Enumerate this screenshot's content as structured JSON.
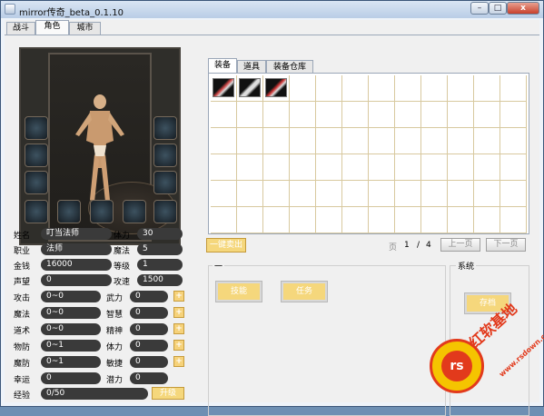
{
  "window": {
    "title": "mirror传奇_beta_0.1.10",
    "minimize": "–",
    "maximize": "□",
    "close": "x"
  },
  "main_tabs": [
    {
      "label": "战斗"
    },
    {
      "label": "角色"
    },
    {
      "label": "城市"
    }
  ],
  "character": {
    "left_stats": [
      {
        "label": "姓名",
        "value": "叮当法师"
      },
      {
        "label": "职业",
        "value": "法师"
      },
      {
        "label": "金钱",
        "value": "16000"
      },
      {
        "label": "声望",
        "value": "0"
      },
      {
        "label": "攻击",
        "value": "0~0"
      },
      {
        "label": "魔法",
        "value": "0~0"
      },
      {
        "label": "道术",
        "value": "0~0"
      },
      {
        "label": "物防",
        "value": "0~1"
      },
      {
        "label": "魔防",
        "value": "0~1"
      },
      {
        "label": "幸运",
        "value": "0"
      },
      {
        "label": "经验",
        "value": "0/50"
      }
    ],
    "right_stats": [
      {
        "label": "体力",
        "value": "30"
      },
      {
        "label": "魔法",
        "value": "5"
      },
      {
        "label": "等级",
        "value": "1"
      },
      {
        "label": "攻速",
        "value": "1500"
      },
      {
        "label": "武力",
        "value": "0"
      },
      {
        "label": "智慧",
        "value": "0"
      },
      {
        "label": "精神",
        "value": "0"
      },
      {
        "label": "体力",
        "value": "0"
      },
      {
        "label": "敏捷",
        "value": "0"
      },
      {
        "label": "潜力",
        "value": "0"
      }
    ],
    "plus_label": "+",
    "upgrade_label": "升级"
  },
  "inventory": {
    "tabs": [
      {
        "label": "装备"
      },
      {
        "label": "道具"
      },
      {
        "label": "装备仓库"
      }
    ],
    "items": [
      {
        "icon": "sword-icon"
      },
      {
        "icon": "armor-icon"
      },
      {
        "icon": "helmet-icon"
      }
    ],
    "sell_all_label": "一键卖出",
    "page_label": "页",
    "current_page": "1",
    "separator": "/",
    "total_pages": "4",
    "prev_label": "上一页",
    "next_label": "下一页"
  },
  "bottom": {
    "group1_title": "一",
    "skill_label": "技能",
    "quest_label": "任务",
    "system_title": "系统",
    "save_label": "存档"
  },
  "watermark": {
    "brand": "红软基地",
    "url": "www.rsdown.cn"
  },
  "colors": {
    "gold_button": "#f5d77c",
    "stat_pill": "#3a3a3a",
    "accent_red": "#e23a1c"
  }
}
